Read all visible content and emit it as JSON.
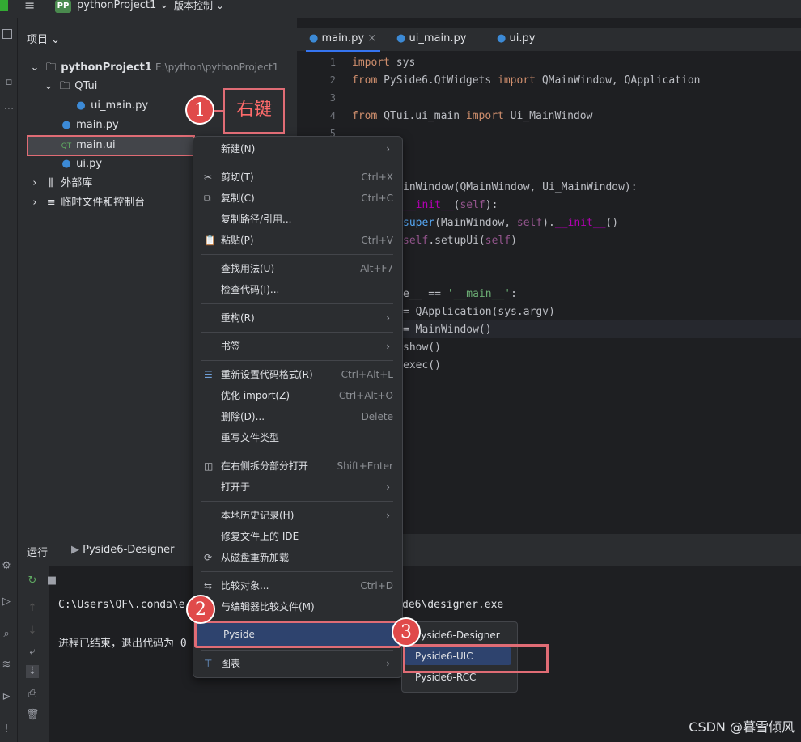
{
  "titlebar": {
    "project_badge": "PP",
    "project_name": "pythonProject1",
    "vcs_label": "版本控制"
  },
  "project_panel": {
    "header": "项目",
    "tree": [
      {
        "label": "pythonProject1",
        "path": "E:\\python\\pythonProject1"
      },
      {
        "label": "QTui"
      },
      {
        "label": "ui_main.py"
      },
      {
        "label": "main.py"
      },
      {
        "label": "main.ui"
      },
      {
        "label": "ui.py"
      },
      {
        "label": "外部库"
      },
      {
        "label": "临时文件和控制台"
      }
    ]
  },
  "tabs": [
    {
      "label": "main.py"
    },
    {
      "label": "ui_main.py"
    },
    {
      "label": "ui.py"
    }
  ],
  "code_lines": [
    "1",
    "2",
    "3",
    "4",
    "5"
  ],
  "run_panel": {
    "title": "运行",
    "tab_label": "Pyside6-Designer",
    "line1": "C:\\Users\\QF\\.conda\\e",
    "line1_tail": "de6\\designer.exe",
    "line2": "进程已结束，退出代码为 0"
  },
  "context_menu": {
    "items": [
      {
        "label": "新建(N)"
      },
      {
        "label": "剪切(T)",
        "shortcut": "Ctrl+X"
      },
      {
        "label": "复制(C)",
        "shortcut": "Ctrl+C"
      },
      {
        "label": "复制路径/引用..."
      },
      {
        "label": "粘贴(P)",
        "shortcut": "Ctrl+V"
      },
      {
        "label": "查找用法(U)",
        "shortcut": "Alt+F7"
      },
      {
        "label": "检查代码(I)..."
      },
      {
        "label": "重构(R)"
      },
      {
        "label": "书签"
      },
      {
        "label": "重新设置代码格式(R)",
        "shortcut": "Ctrl+Alt+L"
      },
      {
        "label": "优化 import(Z)",
        "shortcut": "Ctrl+Alt+O"
      },
      {
        "label": "删除(D)...",
        "shortcut": "Delete"
      },
      {
        "label": "重写文件类型"
      },
      {
        "label": "在右侧拆分部分打开",
        "shortcut": "Shift+Enter"
      },
      {
        "label": "打开于"
      },
      {
        "label": "本地历史记录(H)"
      },
      {
        "label": "修复文件上的 IDE"
      },
      {
        "label": "从磁盘重新加载"
      },
      {
        "label": "比较对象...",
        "shortcut": "Ctrl+D"
      },
      {
        "label": "与编辑器比较文件(M)"
      },
      {
        "label": "Pyside"
      },
      {
        "label": "图表"
      }
    ]
  },
  "submenu": {
    "items": [
      {
        "label": "Pyside6-Designer"
      },
      {
        "label": "Pyside6-UIC"
      },
      {
        "label": "Pyside6-RCC"
      }
    ]
  },
  "callouts": {
    "c1": "1",
    "c1_text": "右键",
    "c2": "2",
    "c3": "3"
  },
  "watermark": "CSDN @暮雪倾风"
}
